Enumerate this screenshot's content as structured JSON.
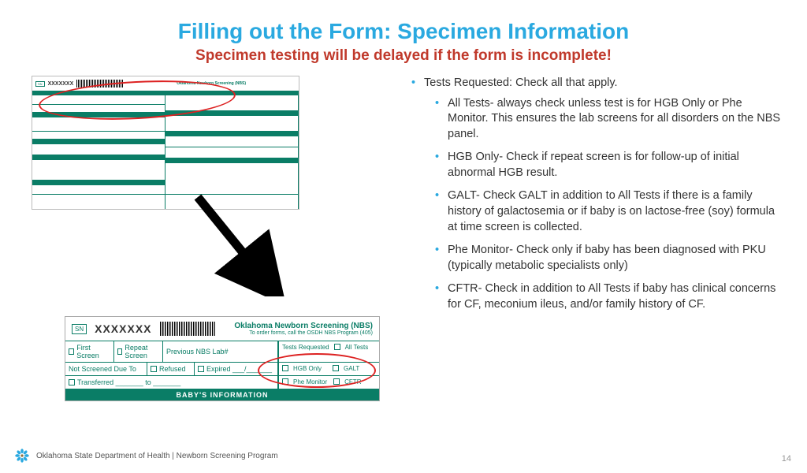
{
  "title": "Filling out the Form: Specimen Information",
  "subtitle": "Specimen testing will be delayed if the form is incomplete!",
  "bullets": {
    "heading": "Tests Requested: Check all that apply.",
    "items": [
      "All Tests- always check unless test is for HGB Only or Phe Monitor. This ensures the lab screens for all disorders on the NBS panel.",
      "HGB Only- Check if repeat screen is for follow-up of initial abnormal HGB result.",
      "GALT- Check GALT in addition to All Tests if there is a family history of galactosemia or if baby is on lactose-free (soy) formula at time screen is collected.",
      "Phe Monitor- Check only if baby has been diagnosed with PKU (typically metabolic specialists only)",
      "CFTR- Check in addition to All Tests if baby has clinical concerns for CF, meconium ileus, and/or family history of CF."
    ]
  },
  "form_small": {
    "serial": "XXXXXXX"
  },
  "form_big": {
    "sn_label": "SN",
    "serial": "XXXXXXX",
    "header_line1": "Oklahoma Newborn Screening (NBS)",
    "header_line2": "To order forms, call the OSDH NBS Program (405)",
    "first_screen": "First Screen",
    "repeat_screen": "Repeat Screen",
    "previous_label": "Previous NBS Lab#",
    "not_screened": "Not Screened Due To",
    "refused": "Refused",
    "expired": "Expired ___/___/___",
    "transferred": "Transferred _______ to _______",
    "tests_requested": "Tests Requested",
    "all_tests": "All Tests",
    "hgb_only": "HGB Only",
    "galt": "GALT",
    "phe_monitor": "Phe Monitor",
    "cftr": "CFTR",
    "baby_info": "BABY'S INFORMATION"
  },
  "footer": "Oklahoma State Department of Health | Newborn Screening Program",
  "page_number": "14"
}
